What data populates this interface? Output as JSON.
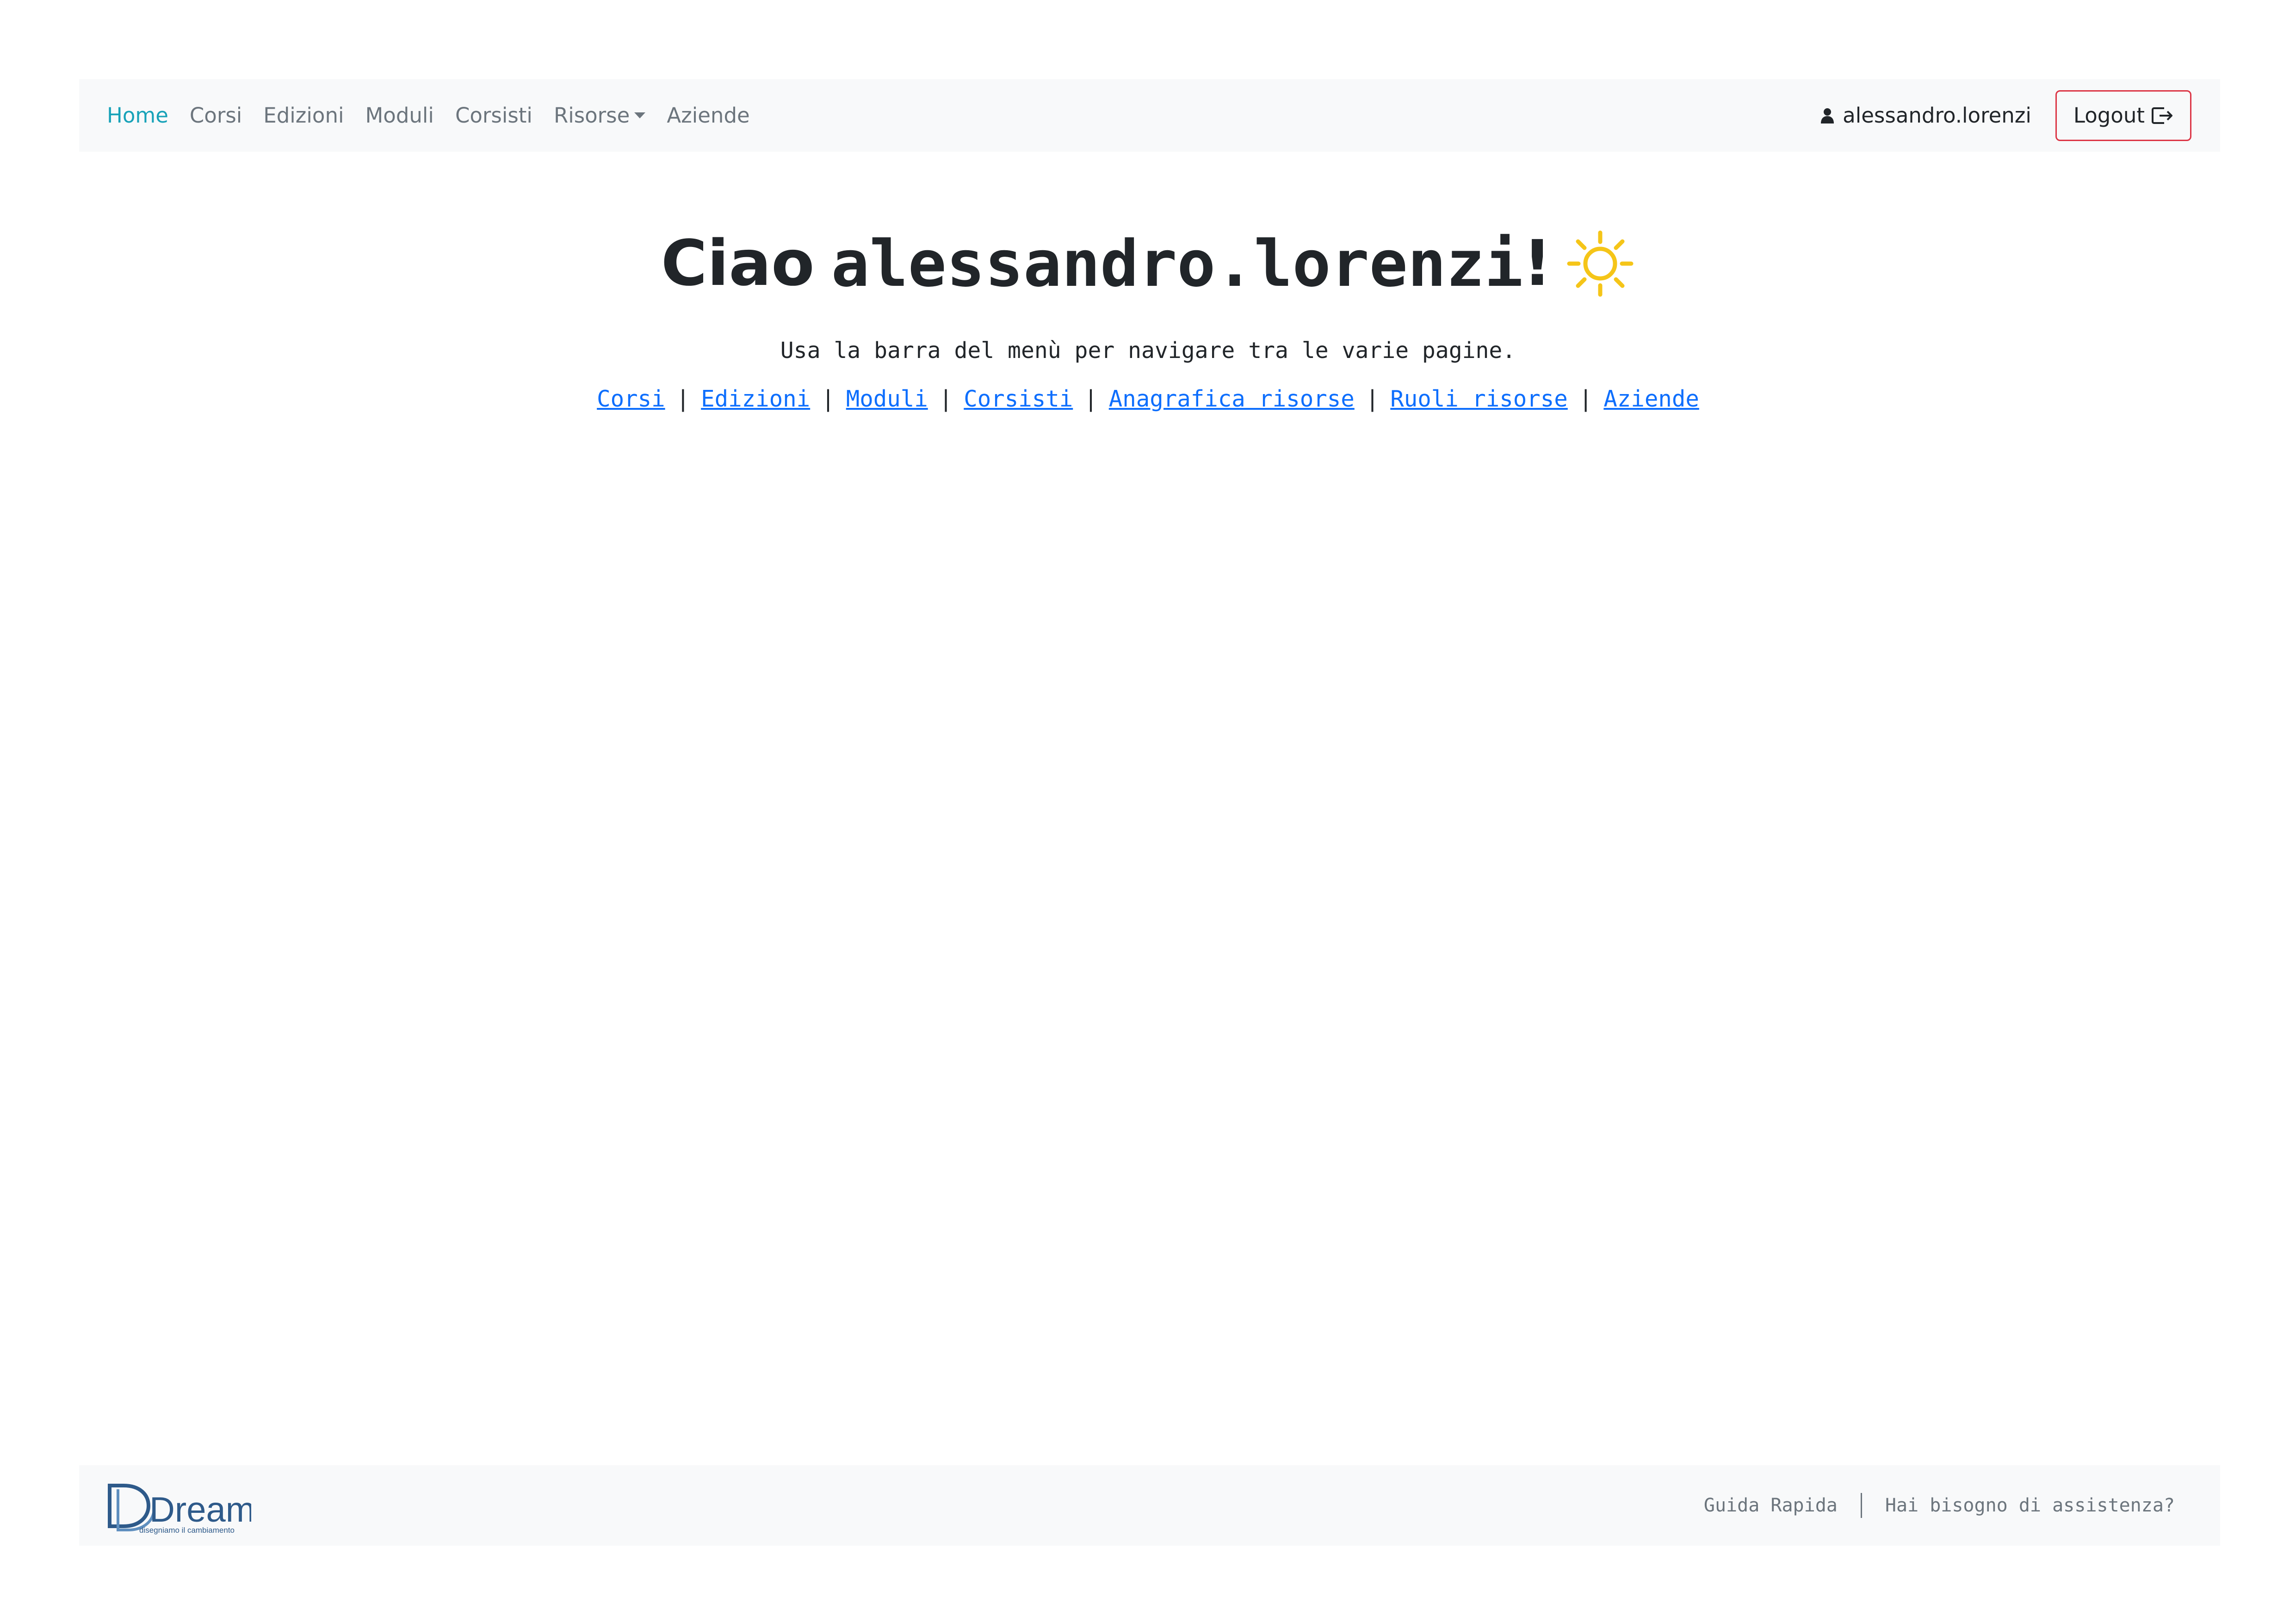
{
  "nav": {
    "items": [
      {
        "label": "Home",
        "active": true
      },
      {
        "label": "Corsi"
      },
      {
        "label": "Edizioni"
      },
      {
        "label": "Moduli"
      },
      {
        "label": "Corsisti"
      },
      {
        "label": "Risorse",
        "dropdown": true
      },
      {
        "label": "Aziende"
      }
    ],
    "user": {
      "name": "alessandro.lorenzi",
      "icon": "user-icon"
    },
    "logout": {
      "label": "Logout",
      "icon": "logout-icon"
    }
  },
  "main": {
    "greeting_word": "Ciao",
    "greeting_name": "alessandro.lorenzi",
    "greeting_suffix": "!",
    "greeting_icon": "sun-icon",
    "instructions": "Usa la barra del menù per navigare tra le varie pagine.",
    "quick_links": [
      "Corsi",
      "Edizioni",
      "Moduli",
      "Corsisti",
      "Anagrafica risorse",
      "Ruoli risorse",
      "Aziende"
    ],
    "separator": "|"
  },
  "footer": {
    "logo": {
      "text": "Dream",
      "tagline": "disegniamo il cambiamento"
    },
    "links": [
      "Guida Rapida",
      "Hai bisogno di assistenza?"
    ]
  },
  "colors": {
    "navbar_bg": "#f8f9fa",
    "active_link": "#17a2b8",
    "muted_link": "#6c757d",
    "logout_border": "#dc3545",
    "link_blue": "#0d6efd",
    "sun": "#f5c518",
    "brand_blue": "#2e5a8a"
  }
}
